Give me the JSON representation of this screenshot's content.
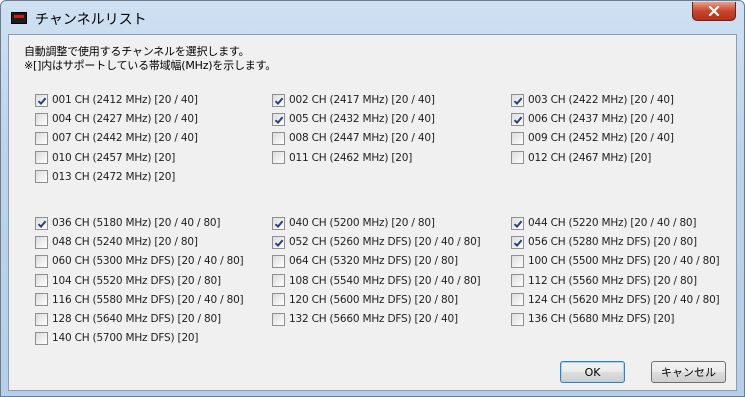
{
  "window": {
    "title": "チャンネルリスト"
  },
  "description": {
    "line1": "自動調整で使用するチャンネルを選択します。",
    "line2": "※[]内はサポートしている帯域幅(MHz)を示します。"
  },
  "channels_24ghz": [
    {
      "label": "001 CH (2412 MHz) [20 / 40]",
      "checked": true
    },
    {
      "label": "002 CH (2417 MHz) [20 / 40]",
      "checked": true
    },
    {
      "label": "003 CH (2422 MHz) [20 / 40]",
      "checked": true
    },
    {
      "label": "004 CH (2427 MHz) [20 / 40]",
      "checked": false
    },
    {
      "label": "005 CH (2432 MHz) [20 / 40]",
      "checked": true
    },
    {
      "label": "006 CH (2437 MHz) [20 / 40]",
      "checked": true
    },
    {
      "label": "007 CH (2442 MHz) [20 / 40]",
      "checked": false
    },
    {
      "label": "008 CH (2447 MHz) [20 / 40]",
      "checked": false
    },
    {
      "label": "009 CH (2452 MHz) [20 / 40]",
      "checked": false
    },
    {
      "label": "010 CH (2457 MHz) [20]",
      "checked": false
    },
    {
      "label": "011 CH (2462 MHz) [20]",
      "checked": false
    },
    {
      "label": "012 CH (2467 MHz) [20]",
      "checked": false
    },
    {
      "label": "013 CH (2472 MHz) [20]",
      "checked": false
    }
  ],
  "channels_5ghz": [
    {
      "label": "036 CH (5180 MHz) [20 / 40 / 80]",
      "checked": true
    },
    {
      "label": "040 CH (5200 MHz) [20 / 80]",
      "checked": true
    },
    {
      "label": "044 CH (5220 MHz) [20 / 40 / 80]",
      "checked": true
    },
    {
      "label": "048 CH (5240 MHz) [20 / 80]",
      "checked": false
    },
    {
      "label": "052 CH (5260 MHz DFS) [20 / 40 / 80]",
      "checked": true
    },
    {
      "label": "056 CH (5280 MHz DFS) [20 / 80]",
      "checked": true
    },
    {
      "label": "060 CH (5300 MHz DFS) [20 / 40 / 80]",
      "checked": false
    },
    {
      "label": "064 CH (5320 MHz DFS) [20 / 80]",
      "checked": false
    },
    {
      "label": "100 CH (5500 MHz DFS) [20 / 40 / 80]",
      "checked": false
    },
    {
      "label": "104 CH (5520 MHz DFS) [20 / 80]",
      "checked": false
    },
    {
      "label": "108 CH (5540 MHz DFS) [20 / 40 / 80]",
      "checked": false
    },
    {
      "label": "112 CH (5560 MHz DFS) [20 / 80]",
      "checked": false
    },
    {
      "label": "116 CH (5580 MHz DFS) [20 / 40 / 80]",
      "checked": false
    },
    {
      "label": "120 CH (5600 MHz DFS) [20 / 80]",
      "checked": false
    },
    {
      "label": "124 CH (5620 MHz DFS) [20 / 40 / 80]",
      "checked": false
    },
    {
      "label": "128 CH (5640 MHz DFS) [20 / 80]",
      "checked": false
    },
    {
      "label": "132 CH (5660 MHz DFS) [20 / 40]",
      "checked": false
    },
    {
      "label": "136 CH (5680 MHz DFS) [20]",
      "checked": false
    },
    {
      "label": "140 CH (5700 MHz DFS) [20]",
      "checked": false
    }
  ],
  "buttons": {
    "ok": "OK",
    "cancel": "キャンセル"
  },
  "icons": {
    "app": "app-icon",
    "close": "close-icon",
    "check": "checkmark-icon"
  },
  "colors": {
    "check": "#2b3f7a",
    "close_button": "#c9452b",
    "default_button_border": "#3c7fb1"
  }
}
